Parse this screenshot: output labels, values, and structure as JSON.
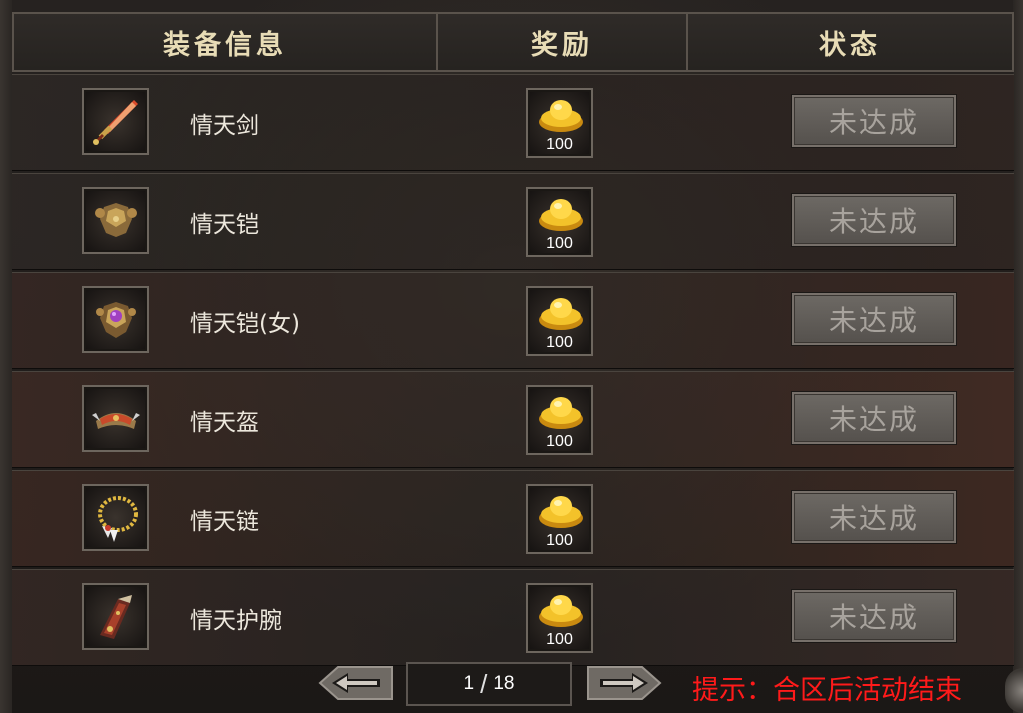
{
  "header": {
    "col_equipment": "装备信息",
    "col_reward": "奖励",
    "col_status": "状态"
  },
  "rows": [
    {
      "name": "情天剑",
      "icon": "sword-icon",
      "reward": "100",
      "status": "未达成"
    },
    {
      "name": "情天铠",
      "icon": "armor-icon",
      "reward": "100",
      "status": "未达成"
    },
    {
      "name": "情天铠(女)",
      "icon": "female-armor-icon",
      "reward": "100",
      "status": "未达成"
    },
    {
      "name": "情天盔",
      "icon": "helmet-icon",
      "reward": "100",
      "status": "未达成"
    },
    {
      "name": "情天链",
      "icon": "necklace-icon",
      "reward": "100",
      "status": "未达成"
    },
    {
      "name": "情天护腕",
      "icon": "bracer-icon",
      "reward": "100",
      "status": "未达成"
    }
  ],
  "reward_icon": "gold-ingot-icon",
  "pagination": {
    "current": "1",
    "separator": "/",
    "total": "18"
  },
  "tip": "提示：合区后活动结束",
  "colors": {
    "tip": "#ff1a1a",
    "header_text": "#e8dcb6",
    "status_text": "#a8a39d"
  }
}
